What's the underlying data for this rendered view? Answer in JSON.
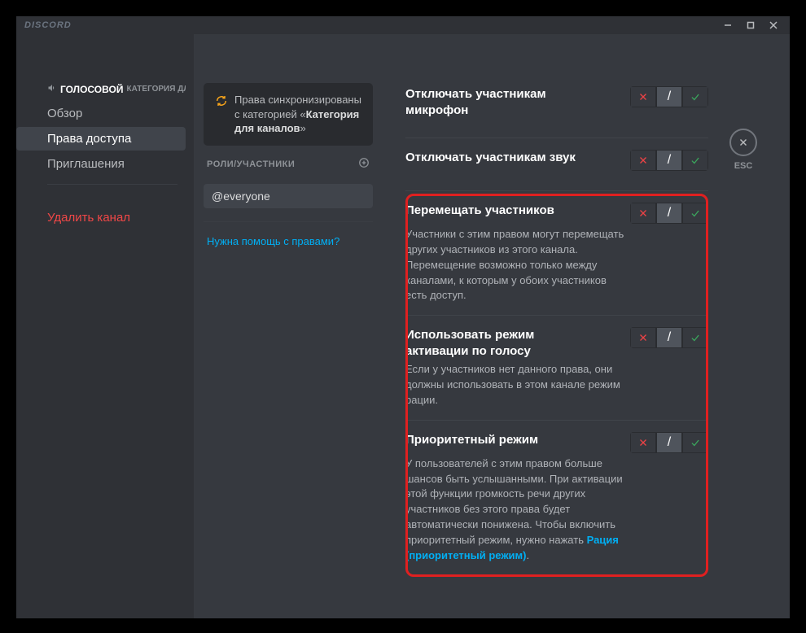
{
  "titlebar": {
    "title": "DISCORD"
  },
  "esc_label": "ESC",
  "sidebar": {
    "channel_name": "ГОЛОСОВОЙ",
    "channel_category": "КАТЕГОРИЯ ДЛ...",
    "items": [
      {
        "label": "Обзор"
      },
      {
        "label": "Права доступа"
      },
      {
        "label": "Приглашения"
      }
    ],
    "delete_label": "Удалить канал"
  },
  "mid": {
    "sync_prefix": "Права синхронизированы с категорией «",
    "sync_category": "Категория для каналов",
    "sync_suffix": "»",
    "roles_header": "РОЛИ/УЧАСТНИКИ",
    "role_everyone": "@everyone",
    "help_link": "Нужна помощь с правами?"
  },
  "permissions": [
    {
      "title": "Отключать участникам микрофон",
      "desc": "",
      "state": "neutral"
    },
    {
      "title": "Отключать участникам звук",
      "desc": "",
      "state": "neutral"
    },
    {
      "title": "Перемещать участников",
      "desc": "Участники с этим правом могут перемещать других участников из этого канала. Перемещение возможно только между каналами, к которым у обоих участников есть доступ.",
      "state": "neutral"
    },
    {
      "title": "Использовать режим активации по голосу",
      "desc": "Если у участников нет данного права, они должны использовать в этом канале режим рации.",
      "state": "neutral"
    },
    {
      "title": "Приоритетный режим",
      "desc_pre": "У пользователей с этим правом больше шансов быть услышанными. При активации этой функции громкость речи других участников без этого права будет автоматически понижена. Чтобы включить приоритетный режим, нужно нажать ",
      "link": "Рация (приоритетный режим)",
      "desc_post": ".",
      "state": "neutral"
    }
  ]
}
